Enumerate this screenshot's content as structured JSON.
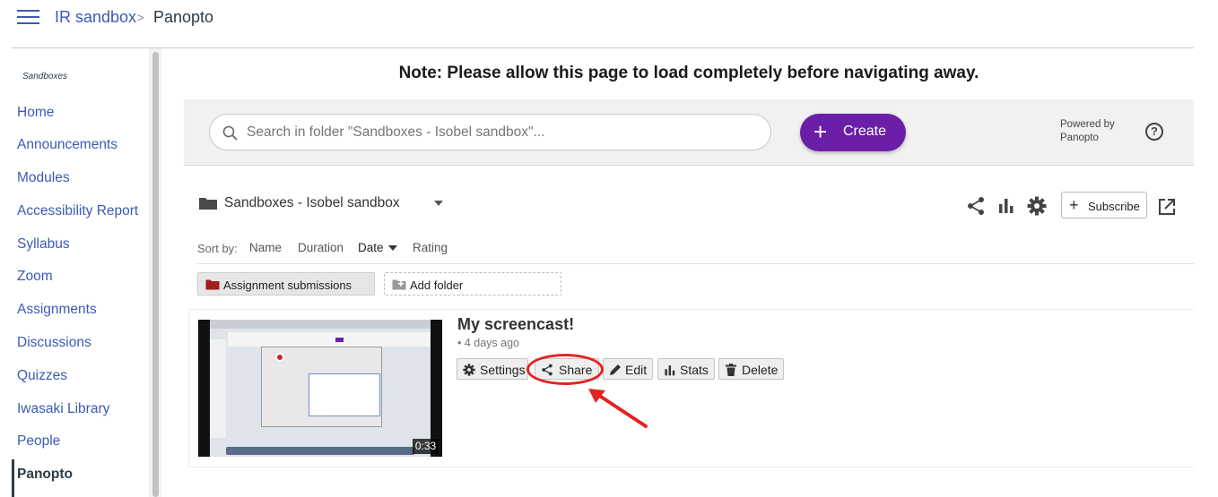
{
  "breadcrumb": {
    "course": "IR sandbox",
    "separator": ">",
    "current": "Panopto"
  },
  "sidebar": {
    "title": "Sandboxes",
    "items": [
      {
        "label": "Home"
      },
      {
        "label": "Announcements"
      },
      {
        "label": "Modules"
      },
      {
        "label": "Accessibility Report"
      },
      {
        "label": "Syllabus"
      },
      {
        "label": "Zoom"
      },
      {
        "label": "Assignments"
      },
      {
        "label": "Discussions"
      },
      {
        "label": "Quizzes"
      },
      {
        "label": "Iwasaki Library"
      },
      {
        "label": "People"
      },
      {
        "label": "Panopto",
        "active": true
      }
    ]
  },
  "note": "Note: Please allow this page to load completely before navigating away.",
  "header": {
    "search_placeholder": "Search in folder \"Sandboxes - Isobel sandbox\"...",
    "create_label": "Create",
    "powered_by": "Powered by Panopto",
    "help_icon": "?"
  },
  "folder": {
    "name": "Sandboxes - Isobel sandbox",
    "subscribe_label": "Subscribe"
  },
  "sort": {
    "label": "Sort by:",
    "options": [
      "Name",
      "Duration",
      "Date",
      "Rating"
    ],
    "active": "Date"
  },
  "subfolders": {
    "assignment_label": "Assignment submissions",
    "add_folder_label": "Add folder"
  },
  "session": {
    "title": "My screencast!",
    "date": "• 4 days ago",
    "duration": "0:33",
    "actions": {
      "settings": "Settings",
      "share": "Share",
      "edit": "Edit",
      "stats": "Stats",
      "delete": "Delete"
    }
  },
  "colors": {
    "link": "#3b5ab4",
    "create_button": "#6b1fa8",
    "annotation": "#e32222"
  }
}
